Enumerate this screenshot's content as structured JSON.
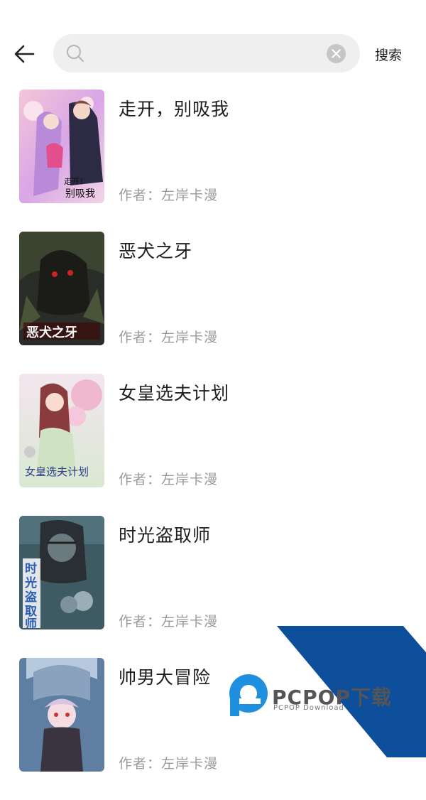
{
  "search": {
    "placeholder": "",
    "value": "",
    "button_label": "搜索"
  },
  "results": [
    {
      "title": "走开，别吸我",
      "author": "作者：左岸卡漫",
      "cover_text": "走开！别吸我"
    },
    {
      "title": "恶犬之牙",
      "author": "作者：左岸卡漫",
      "cover_text": "恶犬之牙"
    },
    {
      "title": "女皇选夫计划",
      "author": "作者：左岸卡漫",
      "cover_text": "女皇选夫计划"
    },
    {
      "title": "时光盗取师",
      "author": "作者：左岸卡漫",
      "cover_text": "时光盗取师"
    },
    {
      "title": "帅男大冒险",
      "author": "作者：左岸卡漫",
      "cover_text": ""
    }
  ],
  "watermark": {
    "brand": "PCPOP下载",
    "sub": "PCPOP Download"
  },
  "colors": {
    "search_bg": "#efefef",
    "author": "#9a9a9a",
    "watermark_blue": "#0d4f9a"
  }
}
